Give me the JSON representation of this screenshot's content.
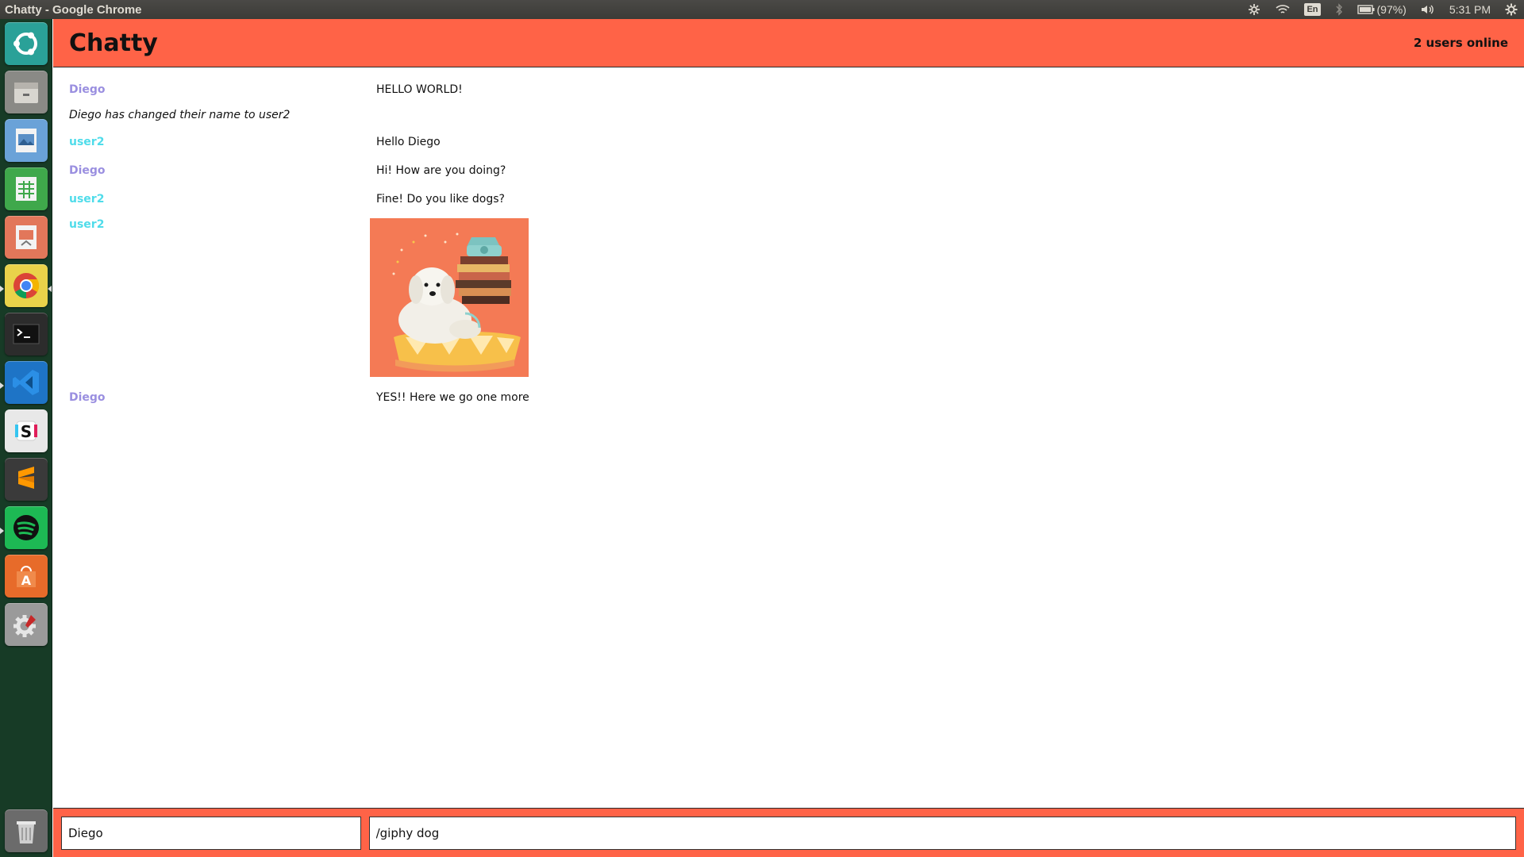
{
  "window": {
    "title": "Chatty - Google Chrome"
  },
  "tray": {
    "keyboard": "En",
    "battery": "(97%)",
    "clock": "5:31 PM"
  },
  "launcher": {
    "items": [
      {
        "name": "ubuntu-dash-icon",
        "color": "#2aa198"
      },
      {
        "name": "file-manager-icon",
        "color": "#8a8a86"
      },
      {
        "name": "image-viewer-icon",
        "color": "#6aa2d8"
      },
      {
        "name": "spreadsheet-icon",
        "color": "#3fa84b"
      },
      {
        "name": "presentation-icon",
        "color": "#e2775a"
      },
      {
        "name": "chrome-icon",
        "color": "#e9d24a"
      },
      {
        "name": "terminal-icon",
        "color": "#2c2c2c"
      },
      {
        "name": "vscode-icon",
        "color": "#1e74c6"
      },
      {
        "name": "slack-icon",
        "color": "#e8e8e8"
      },
      {
        "name": "sublime-text-icon",
        "color": "#3a3a3a"
      },
      {
        "name": "spotify-icon",
        "color": "#1db954"
      },
      {
        "name": "software-center-icon",
        "color": "#e76b2a"
      },
      {
        "name": "system-settings-icon",
        "color": "#9a9a9a"
      },
      {
        "name": "trash-icon",
        "color": "#6b6b6b"
      }
    ]
  },
  "app": {
    "brand": "Chatty",
    "online": "2 users online",
    "accent": "#ff6347"
  },
  "messages": [
    {
      "type": "text",
      "user": "Diego",
      "user_color": "#9a8fe0",
      "content": "HELLO WORLD!"
    },
    {
      "type": "system",
      "content": "Diego has changed their name to user2"
    },
    {
      "type": "text",
      "user": "user2",
      "user_color": "#4fdcea",
      "content": "Hello Diego"
    },
    {
      "type": "text",
      "user": "Diego",
      "user_color": "#9a8fe0",
      "content": "Hi! How are you doing?"
    },
    {
      "type": "text",
      "user": "user2",
      "user_color": "#4fdcea",
      "content": "Fine! Do you like dogs?"
    },
    {
      "type": "image",
      "user": "user2",
      "user_color": "#4fdcea"
    },
    {
      "type": "text",
      "user": "Diego",
      "user_color": "#9a8fe0",
      "content": "YES!! Here we go one more"
    }
  ],
  "chatbar": {
    "name_value": "Diego",
    "message_value": "/giphy dog"
  }
}
